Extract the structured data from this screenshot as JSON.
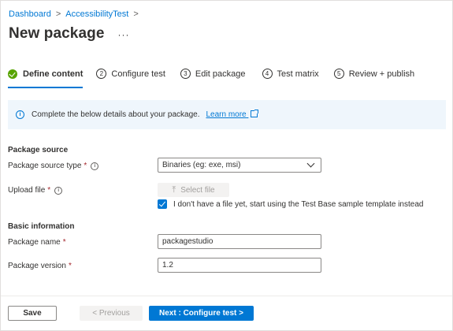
{
  "breadcrumb": {
    "items": [
      "Dashboard",
      "AccessibilityTest"
    ],
    "separator": ">"
  },
  "header": {
    "title": "New package",
    "more_label": "···"
  },
  "steps": [
    {
      "number": "",
      "label": "Define content",
      "status": "complete",
      "active": true
    },
    {
      "number": "2",
      "label": "Configure test"
    },
    {
      "number": "3",
      "label": "Edit package"
    },
    {
      "number": "4",
      "label": "Test matrix"
    },
    {
      "number": "5",
      "label": "Review + publish"
    }
  ],
  "info_banner": {
    "icon": "info-icon",
    "text": "Complete the below details about your package.",
    "link_label": "Learn more"
  },
  "package_source": {
    "section_title": "Package source",
    "type_label": "Package source type",
    "type_value": "Binaries (eg: exe, msi)",
    "upload_label": "Upload file",
    "select_file_label": "Select file",
    "checkbox_checked": true,
    "checkbox_label": "I don't have a file yet, start using the Test Base sample template instead"
  },
  "basic_info": {
    "section_title": "Basic information",
    "name_label": "Package name",
    "name_value": "packagestudio",
    "version_label": "Package version",
    "version_value": "1.2"
  },
  "required_marker": "*",
  "footer": {
    "save_label": "Save",
    "previous_label": "< Previous",
    "next_label": "Next : Configure test >"
  },
  "colors": {
    "accent": "#0078d4",
    "success": "#57a300",
    "required": "#a4262c",
    "banner_bg": "#eff6fc"
  }
}
